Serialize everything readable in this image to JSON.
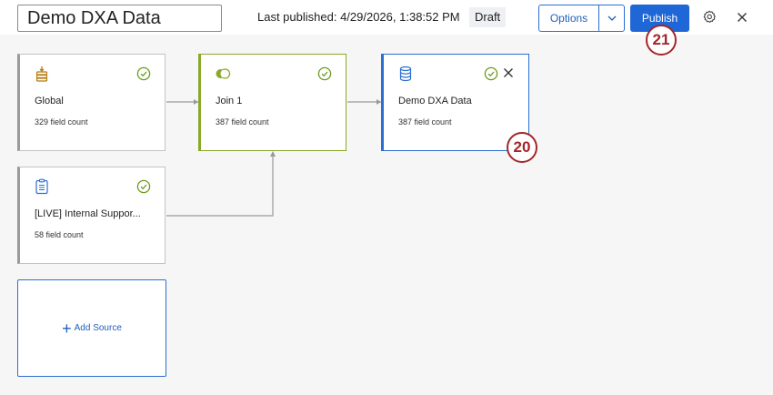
{
  "header": {
    "title": "Demo DXA Data",
    "last_published": "Last published: 4/29/2026, 1:38:52 PM",
    "status": "Draft",
    "options_label": "Options",
    "publish_label": "Publish",
    "icons": [
      "chevron-down-icon",
      "gear-icon",
      "close-icon"
    ]
  },
  "markers": {
    "publish": "21",
    "output_card": "20"
  },
  "nodes": {
    "global": {
      "name": "Global",
      "count": "329 field count",
      "icon": "database-stack-icon"
    },
    "internal": {
      "name": "[LIVE] Internal Suppor...",
      "count": "58 field count",
      "icon": "clipboard-icon"
    },
    "join": {
      "name": "Join 1",
      "count": "387 field count",
      "icon": "join-icon"
    },
    "output": {
      "name": "Demo DXA Data",
      "count": "387 field count",
      "icon": "dataset-icon"
    }
  },
  "add_source_label": "Add Source",
  "colors": {
    "accent": "#1f66d6",
    "join": "#8aa829",
    "success": "#6c9a1c",
    "marker": "#a3262a"
  }
}
